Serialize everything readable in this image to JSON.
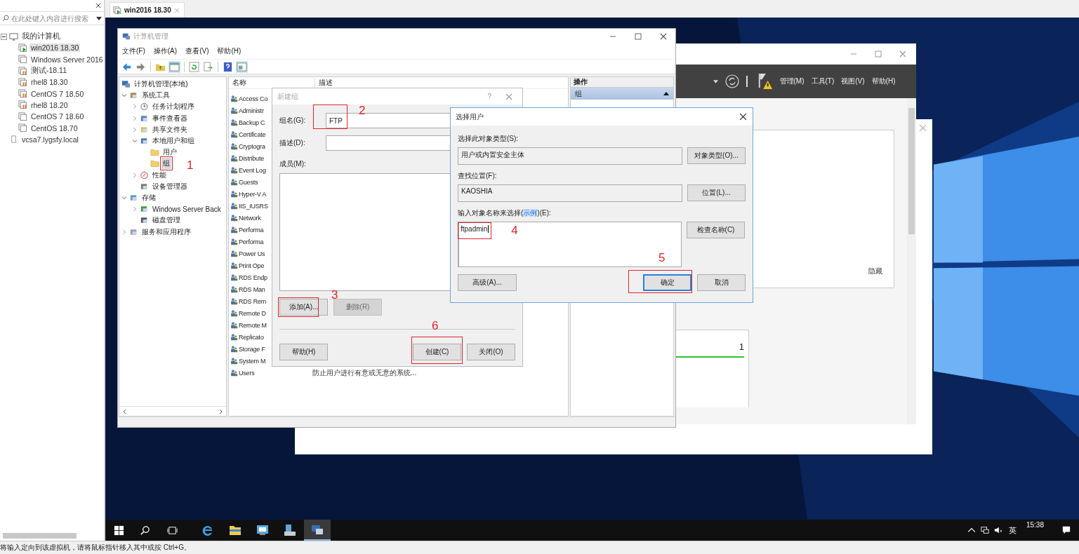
{
  "client": {
    "search": {
      "placeholder": "在此处键入内容进行搜索"
    },
    "tree": [
      {
        "label": "我的计算机",
        "expanded": true,
        "selected": false,
        "children": [
          {
            "label": "win2016 18.30",
            "running": true,
            "suspended": false,
            "selected": true
          },
          {
            "label": "Windows Server 2016",
            "running": false,
            "suspended": false,
            "selected": false
          },
          {
            "label": "测试-18.11",
            "running": false,
            "suspended": true,
            "selected": false
          },
          {
            "label": "rhel8 18.30",
            "running": false,
            "suspended": true,
            "selected": false
          },
          {
            "label": "CentOS 7  18.50",
            "running": false,
            "suspended": true,
            "selected": false
          },
          {
            "label": "rhel8 18.20",
            "running": false,
            "suspended": true,
            "selected": false
          },
          {
            "label": "CentOS 7 18.60",
            "running": false,
            "suspended": false,
            "selected": false
          },
          {
            "label": "CentOS 18.70",
            "running": false,
            "suspended": false,
            "selected": false
          }
        ]
      },
      {
        "label": "vcsa7.lygsfy.local",
        "selected": false
      }
    ]
  },
  "tab": {
    "label": "win2016 18.30"
  },
  "computer_management": {
    "title": "计算机管理",
    "menu": [
      "文件(F)",
      "操作(A)",
      "查看(V)",
      "帮助(H)"
    ],
    "tree": [
      {
        "label": "计算机管理(本地)",
        "kind": "computer",
        "selected": false,
        "children": [
          {
            "label": "系统工具",
            "kind": "tool",
            "expanded": true,
            "selected": false,
            "children": [
              {
                "label": "任务计划程序",
                "kind": "clock",
                "expanded": false,
                "selected": false
              },
              {
                "label": "事件查看器",
                "kind": "log",
                "expanded": false,
                "selected": false
              },
              {
                "label": "共享文件夹",
                "kind": "share",
                "expanded": false,
                "selected": false
              },
              {
                "label": "本地用户和组",
                "kind": "users",
                "expanded": true,
                "selected": false,
                "children": [
                  {
                    "label": "用户",
                    "kind": "folder",
                    "selected": false
                  },
                  {
                    "label": "组",
                    "kind": "folder",
                    "selected": true,
                    "annotation": "1"
                  }
                ]
              },
              {
                "label": "性能",
                "kind": "perf",
                "expanded": false,
                "selected": false
              },
              {
                "label": "设备管理器",
                "kind": "device",
                "selected": false
              }
            ]
          },
          {
            "label": "存储",
            "kind": "storage",
            "expanded": true,
            "selected": false,
            "children": [
              {
                "label": "Windows Server Back",
                "kind": "backup",
                "expanded": false,
                "selected": false
              },
              {
                "label": "磁盘管理",
                "kind": "disk",
                "selected": false
              }
            ]
          },
          {
            "label": "服务和应用程序",
            "kind": "services",
            "expanded": false,
            "selected": false
          }
        ]
      }
    ],
    "columns": [
      "名称",
      "描述"
    ],
    "rows": [
      {
        "name": "Access Co"
      },
      {
        "name": "Administr"
      },
      {
        "name": "Backup C"
      },
      {
        "name": "Certificate"
      },
      {
        "name": "Cryptogra"
      },
      {
        "name": "Distribute"
      },
      {
        "name": "Event Log"
      },
      {
        "name": "Guests"
      },
      {
        "name": "Hyper-V A"
      },
      {
        "name": "IIS_IUSRS"
      },
      {
        "name": "Network"
      },
      {
        "name": "Performa"
      },
      {
        "name": "Performa"
      },
      {
        "name": "Power Us"
      },
      {
        "name": "Print Ope"
      },
      {
        "name": "RDS Endp"
      },
      {
        "name": "RDS Man"
      },
      {
        "name": "RDS Rem"
      },
      {
        "name": "Remote D"
      },
      {
        "name": "Remote M"
      },
      {
        "name": "Replicato"
      },
      {
        "name": "Storage F"
      },
      {
        "name": "System M"
      },
      {
        "name": "Users",
        "description": "防止用户进行有意或无意的系统..."
      }
    ],
    "actions": {
      "header": "操作",
      "section": "组"
    }
  },
  "new_group": {
    "title": "新建组",
    "help": "?",
    "fields": [
      {
        "label": "组名(G):",
        "value": "FTP",
        "annotation": "2"
      },
      {
        "label": "描述(D):"
      }
    ],
    "members_label": "成员(M):",
    "member_buttons": [
      {
        "label": "添加(A)...",
        "disabled": false,
        "annotation": "3"
      },
      {
        "label": "删除(R)",
        "disabled": true
      }
    ],
    "footer_buttons": [
      {
        "label": "帮助(H)"
      },
      {
        "label": "创建(C)",
        "annotation": "6"
      },
      {
        "label": "关闭(O)"
      }
    ]
  },
  "select_user": {
    "title": "选择用户",
    "object_type": {
      "label": "选择此对象类型(S):",
      "value": "用户或内置安全主体",
      "button": "对象类型(O)..."
    },
    "location": {
      "label": "查找位置(F):",
      "value": "KAOSHIA",
      "button": "位置(L)..."
    },
    "names": {
      "label_before": "输入对象名称来选择(",
      "link": "示例",
      "label_after": ")(E):",
      "value": "ftpadmin",
      "annotation": "4",
      "button": "检查名称(C)"
    },
    "buttons": [
      {
        "label": "高级(A)...",
        "default": false
      },
      {
        "label": "确定",
        "default": true,
        "annotation": "5"
      },
      {
        "label": "取消",
        "default": false
      }
    ]
  },
  "server_manager": {
    "menu": [
      "管理(M)",
      "工具(T)",
      "视图(V)",
      "帮助(H)"
    ],
    "hide_link": "隐藏",
    "tile_count": "1"
  },
  "taskbar": {
    "apps": [
      {
        "kind": "ie",
        "active": false
      },
      {
        "kind": "explorer",
        "active": false
      },
      {
        "kind": "server",
        "active": false
      },
      {
        "kind": "tool",
        "active": false
      },
      {
        "kind": "mmc",
        "active": true
      }
    ],
    "ime": "英",
    "time": "15:38"
  },
  "status_bar": "将输入定向到该虚拟机，请将鼠标指针移入其中或按 Ctrl+G。"
}
